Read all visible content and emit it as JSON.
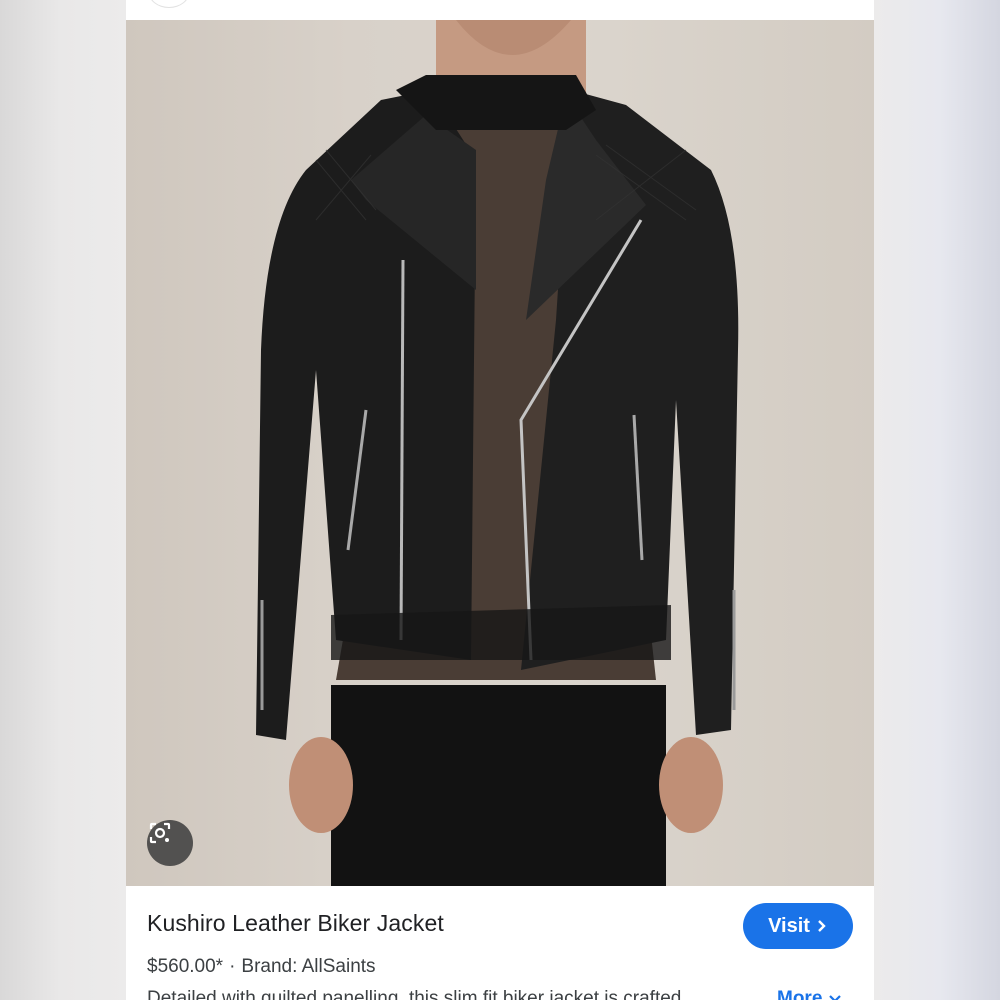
{
  "product": {
    "title": "Kushiro Leather Biker Jacket",
    "price": "$560.00*",
    "separator": "·",
    "brand": "Brand: AllSaints",
    "description": "Detailed with quilted panelling, this slim fit biker jacket is crafted",
    "more_label": "More"
  },
  "actions": {
    "visit_label": "Visit",
    "visit_icon": "chevron-right-icon",
    "lens_icon": "image-search-icon",
    "more_icon": "chevron-down-icon"
  },
  "colors": {
    "accent": "#1a73e8",
    "text_primary": "#202124",
    "text_secondary": "#3c4043"
  }
}
